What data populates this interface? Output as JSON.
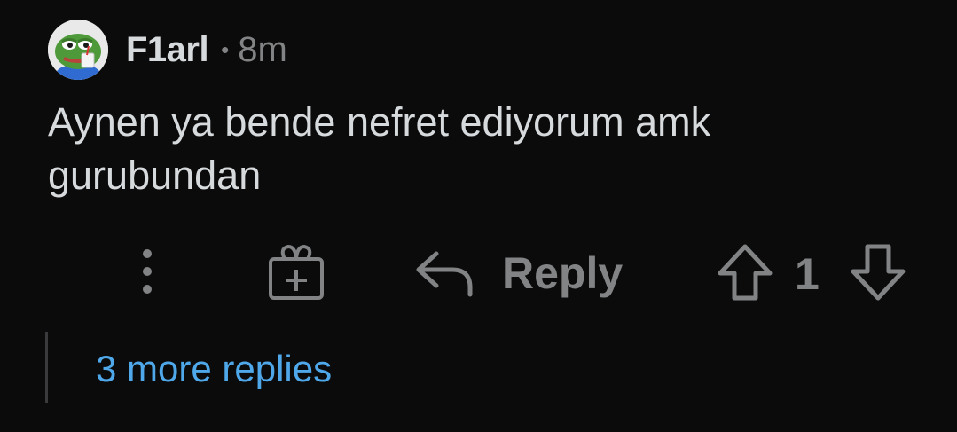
{
  "comment": {
    "username": "F1arl",
    "separator": "•",
    "time": "8m",
    "text": "Aynen ya bende nefret ediyorum amk gurubundan",
    "avatar_icon": "pepe-frog-avatar"
  },
  "actions": {
    "more_icon": "vertical-dots-icon",
    "award_icon": "gift-award-icon",
    "reply_icon": "reply-arrow-icon",
    "reply_label": "Reply",
    "upvote_icon": "upvote-arrow-icon",
    "score": "1",
    "downvote_icon": "downvote-arrow-icon"
  },
  "replies": {
    "more_label": "3 more replies"
  },
  "colors": {
    "background": "#0b0b0b",
    "text": "#d7dadc",
    "muted": "#818384",
    "link": "#4fa8ea"
  }
}
